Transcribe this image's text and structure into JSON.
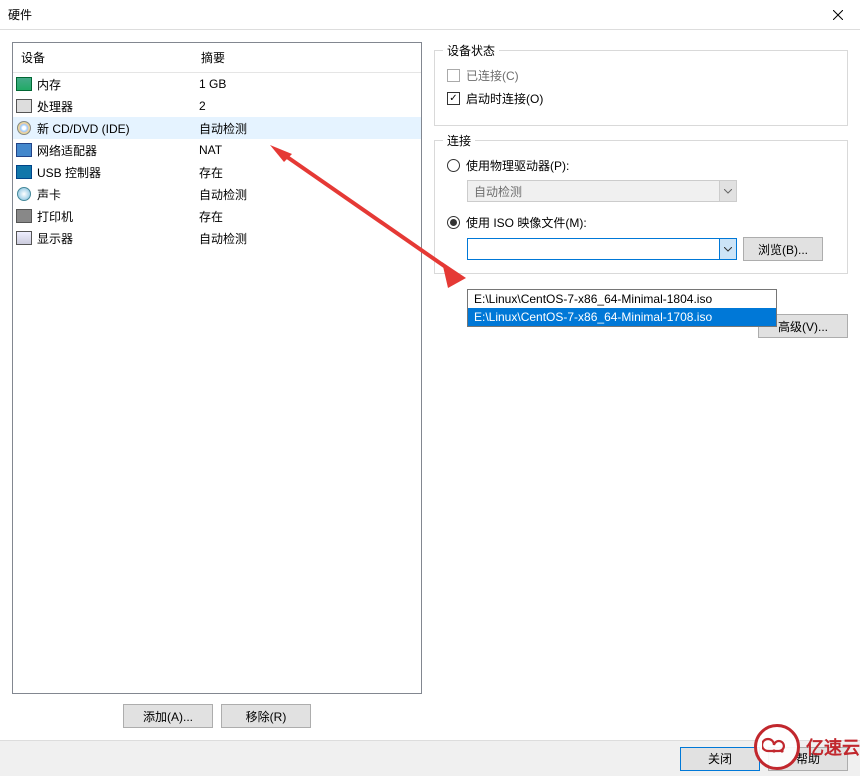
{
  "window": {
    "title": "硬件"
  },
  "device_table": {
    "header_device": "设备",
    "header_summary": "摘要",
    "rows": [
      {
        "name": "内存",
        "summary": "1 GB",
        "icon": "memory-icon"
      },
      {
        "name": "处理器",
        "summary": "2",
        "icon": "cpu-icon"
      },
      {
        "name": "新 CD/DVD (IDE)",
        "summary": "自动检测",
        "icon": "cd-icon",
        "selected": true
      },
      {
        "name": "网络适配器",
        "summary": "NAT",
        "icon": "network-icon"
      },
      {
        "name": "USB 控制器",
        "summary": "存在",
        "icon": "usb-icon"
      },
      {
        "name": "声卡",
        "summary": "自动检测",
        "icon": "sound-icon"
      },
      {
        "name": "打印机",
        "summary": "存在",
        "icon": "printer-icon"
      },
      {
        "name": "显示器",
        "summary": "自动检测",
        "icon": "display-icon"
      }
    ]
  },
  "buttons": {
    "add": "添加(A)...",
    "remove": "移除(R)",
    "browse": "浏览(B)...",
    "advanced": "高级(V)...",
    "close": "关闭",
    "help": "帮助"
  },
  "status_group": {
    "title": "设备状态",
    "connected_label": "已连接(C)",
    "connect_at_poweron_label": "启动时连接(O)"
  },
  "connection_group": {
    "title": "连接",
    "use_physical_label": "使用物理驱动器(P):",
    "physical_value": "自动检测",
    "use_iso_label": "使用 ISO 映像文件(M):",
    "iso_value": "",
    "dropdown_options": [
      "E:\\Linux\\CentOS-7-x86_64-Minimal-1804.iso",
      "E:\\Linux\\CentOS-7-x86_64-Minimal-1708.iso"
    ]
  },
  "watermark": {
    "text": "亿速云",
    "icon_text": "ဆ"
  }
}
